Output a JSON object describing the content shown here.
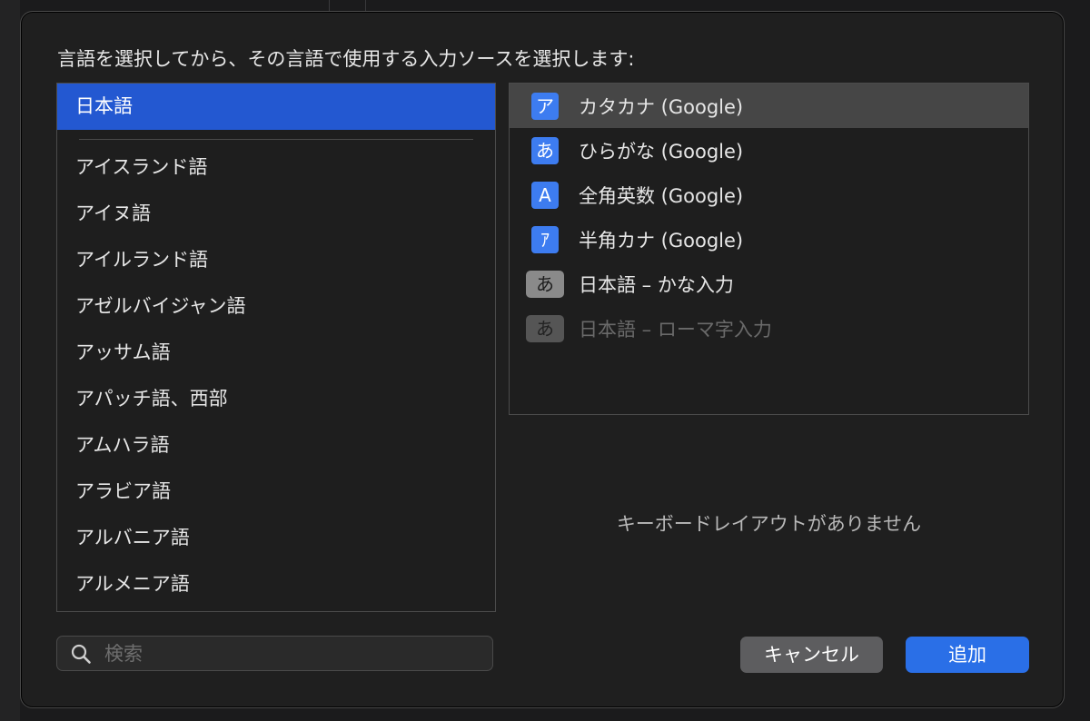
{
  "prompt": "言語を選択してから、その言語で使用する入力ソースを選択します:",
  "languages": {
    "selected": "日本語",
    "items": [
      "アイスランド語",
      "アイヌ語",
      "アイルランド語",
      "アゼルバイジャン語",
      "アッサム語",
      "アパッチ語、西部",
      "アムハラ語",
      "アラビア語",
      "アルバニア語",
      "アルメニア語"
    ]
  },
  "sources": [
    {
      "glyph": "ア",
      "label": "カタカナ (Google)",
      "selected": true
    },
    {
      "glyph": "あ",
      "label": "ひらがな (Google)"
    },
    {
      "glyph": "A",
      "label": "全角英数 (Google)"
    },
    {
      "glyph": "ｱ",
      "label": "半角カナ (Google)"
    },
    {
      "glyph": "あ",
      "label": "日本語 – かな入力"
    },
    {
      "glyph": "あ",
      "label": "日本語 – ローマ字入力",
      "disabled": true
    }
  ],
  "no_layout_text": "キーボードレイアウトがありません",
  "search": {
    "placeholder": "検索",
    "value": ""
  },
  "buttons": {
    "cancel": "キャンセル",
    "add": "追加"
  },
  "colors": {
    "accent": "#2a6fe7",
    "selection": "#2358d1",
    "icon_blue": "#3d7cf0"
  }
}
